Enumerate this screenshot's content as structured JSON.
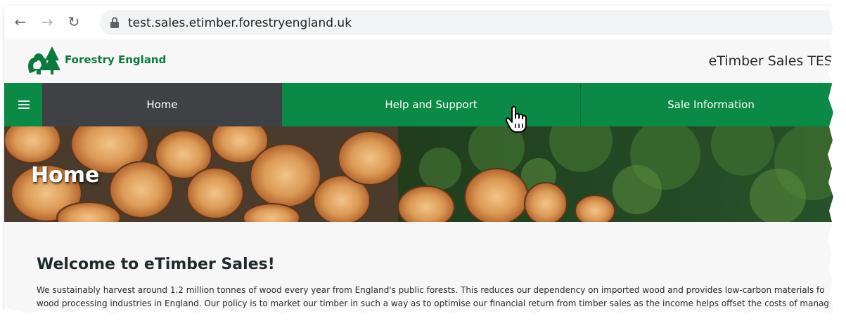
{
  "browser": {
    "back_icon": "arrow-left-icon",
    "forward_icon": "arrow-right-icon",
    "reload_icon": "reload-icon",
    "url": "test.sales.etimber.forestryengland.uk"
  },
  "header": {
    "brand": "Forestry England",
    "app_title": "eTimber Sales TES"
  },
  "nav": {
    "items": [
      {
        "label": "Home"
      },
      {
        "label": "Help and Support"
      },
      {
        "label": "Sale Information"
      }
    ]
  },
  "hero": {
    "title": "Home"
  },
  "content": {
    "heading": "Welcome to eTimber Sales!",
    "paragraph_line1": "We sustainably harvest around 1.2 million tonnes of wood every year from England's public forests. This reduces our dependency on imported wood and provides low-carbon materials fo",
    "paragraph_line2": "wood processing industries in England. Our policy is to market our timber in such a way as to optimise our financial return from timber sales as the income helps offset the costs of manag"
  },
  "colors": {
    "brand_green": "#0a8a45",
    "active_nav": "#3f4244"
  }
}
